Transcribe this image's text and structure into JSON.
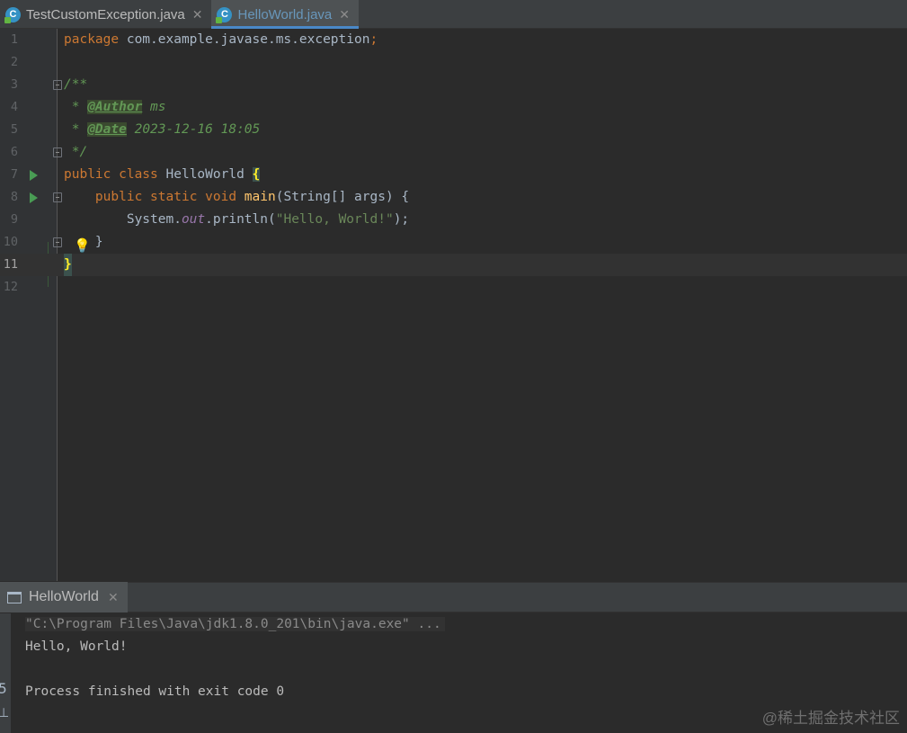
{
  "tabs": [
    {
      "label": "TestCustomException.java",
      "active": false
    },
    {
      "label": "HelloWorld.java",
      "active": true
    }
  ],
  "tab_close_glyph": "✕",
  "editor": {
    "line_numbers": [
      "1",
      "2",
      "3",
      "4",
      "5",
      "6",
      "7",
      "8",
      "9",
      "10",
      "11",
      "12"
    ],
    "current_line": "11",
    "line1": {
      "kw": "package",
      "rest": " com.example.javase.ms.exception",
      "semi": ";"
    },
    "line3": "/**",
    "line4": {
      "star": " * ",
      "tag": "@Author",
      "value": " ms"
    },
    "line5": {
      "star": " * ",
      "tag": "@Date",
      "value": " 2023-12-16 18:05"
    },
    "line6": " */",
    "line7": {
      "kw1": "public",
      "kw2": " class",
      "name": " HelloWorld ",
      "brace": "{"
    },
    "line8": {
      "indent": "    ",
      "kw1": "public",
      "kw2": " static",
      "kw3": " void",
      "fn": " main",
      "rest": "(String[] args) {"
    },
    "line9": {
      "indent": "        ",
      "obj": "System.",
      "field": "out",
      "call": ".println(",
      "str": "\"Hello, World!\"",
      "end": ");"
    },
    "line10": "    }",
    "line11": "}"
  },
  "run_panel": {
    "tab_label": "HelloWorld",
    "close_glyph": "✕",
    "console": {
      "command": "\"C:\\Program Files\\Java\\jdk1.8.0_201\\bin\\java.exe\" ...",
      "output": "Hello, World!",
      "exit": "Process finished with exit code 0"
    }
  },
  "watermark": "@稀土掘金技术社区",
  "icons": {
    "tab_file": "java-class-icon",
    "run_gutter": "run-arrow-icon",
    "fold": "fold-marker-icon",
    "bulb": "lightbulb-icon",
    "run_tab": "terminal-icon"
  },
  "colors": {
    "keyword": "#cc7832",
    "comment": "#629755",
    "string": "#6a8759",
    "field": "#9876aa",
    "method": "#ffc66d",
    "accent": "#4a88c7"
  }
}
